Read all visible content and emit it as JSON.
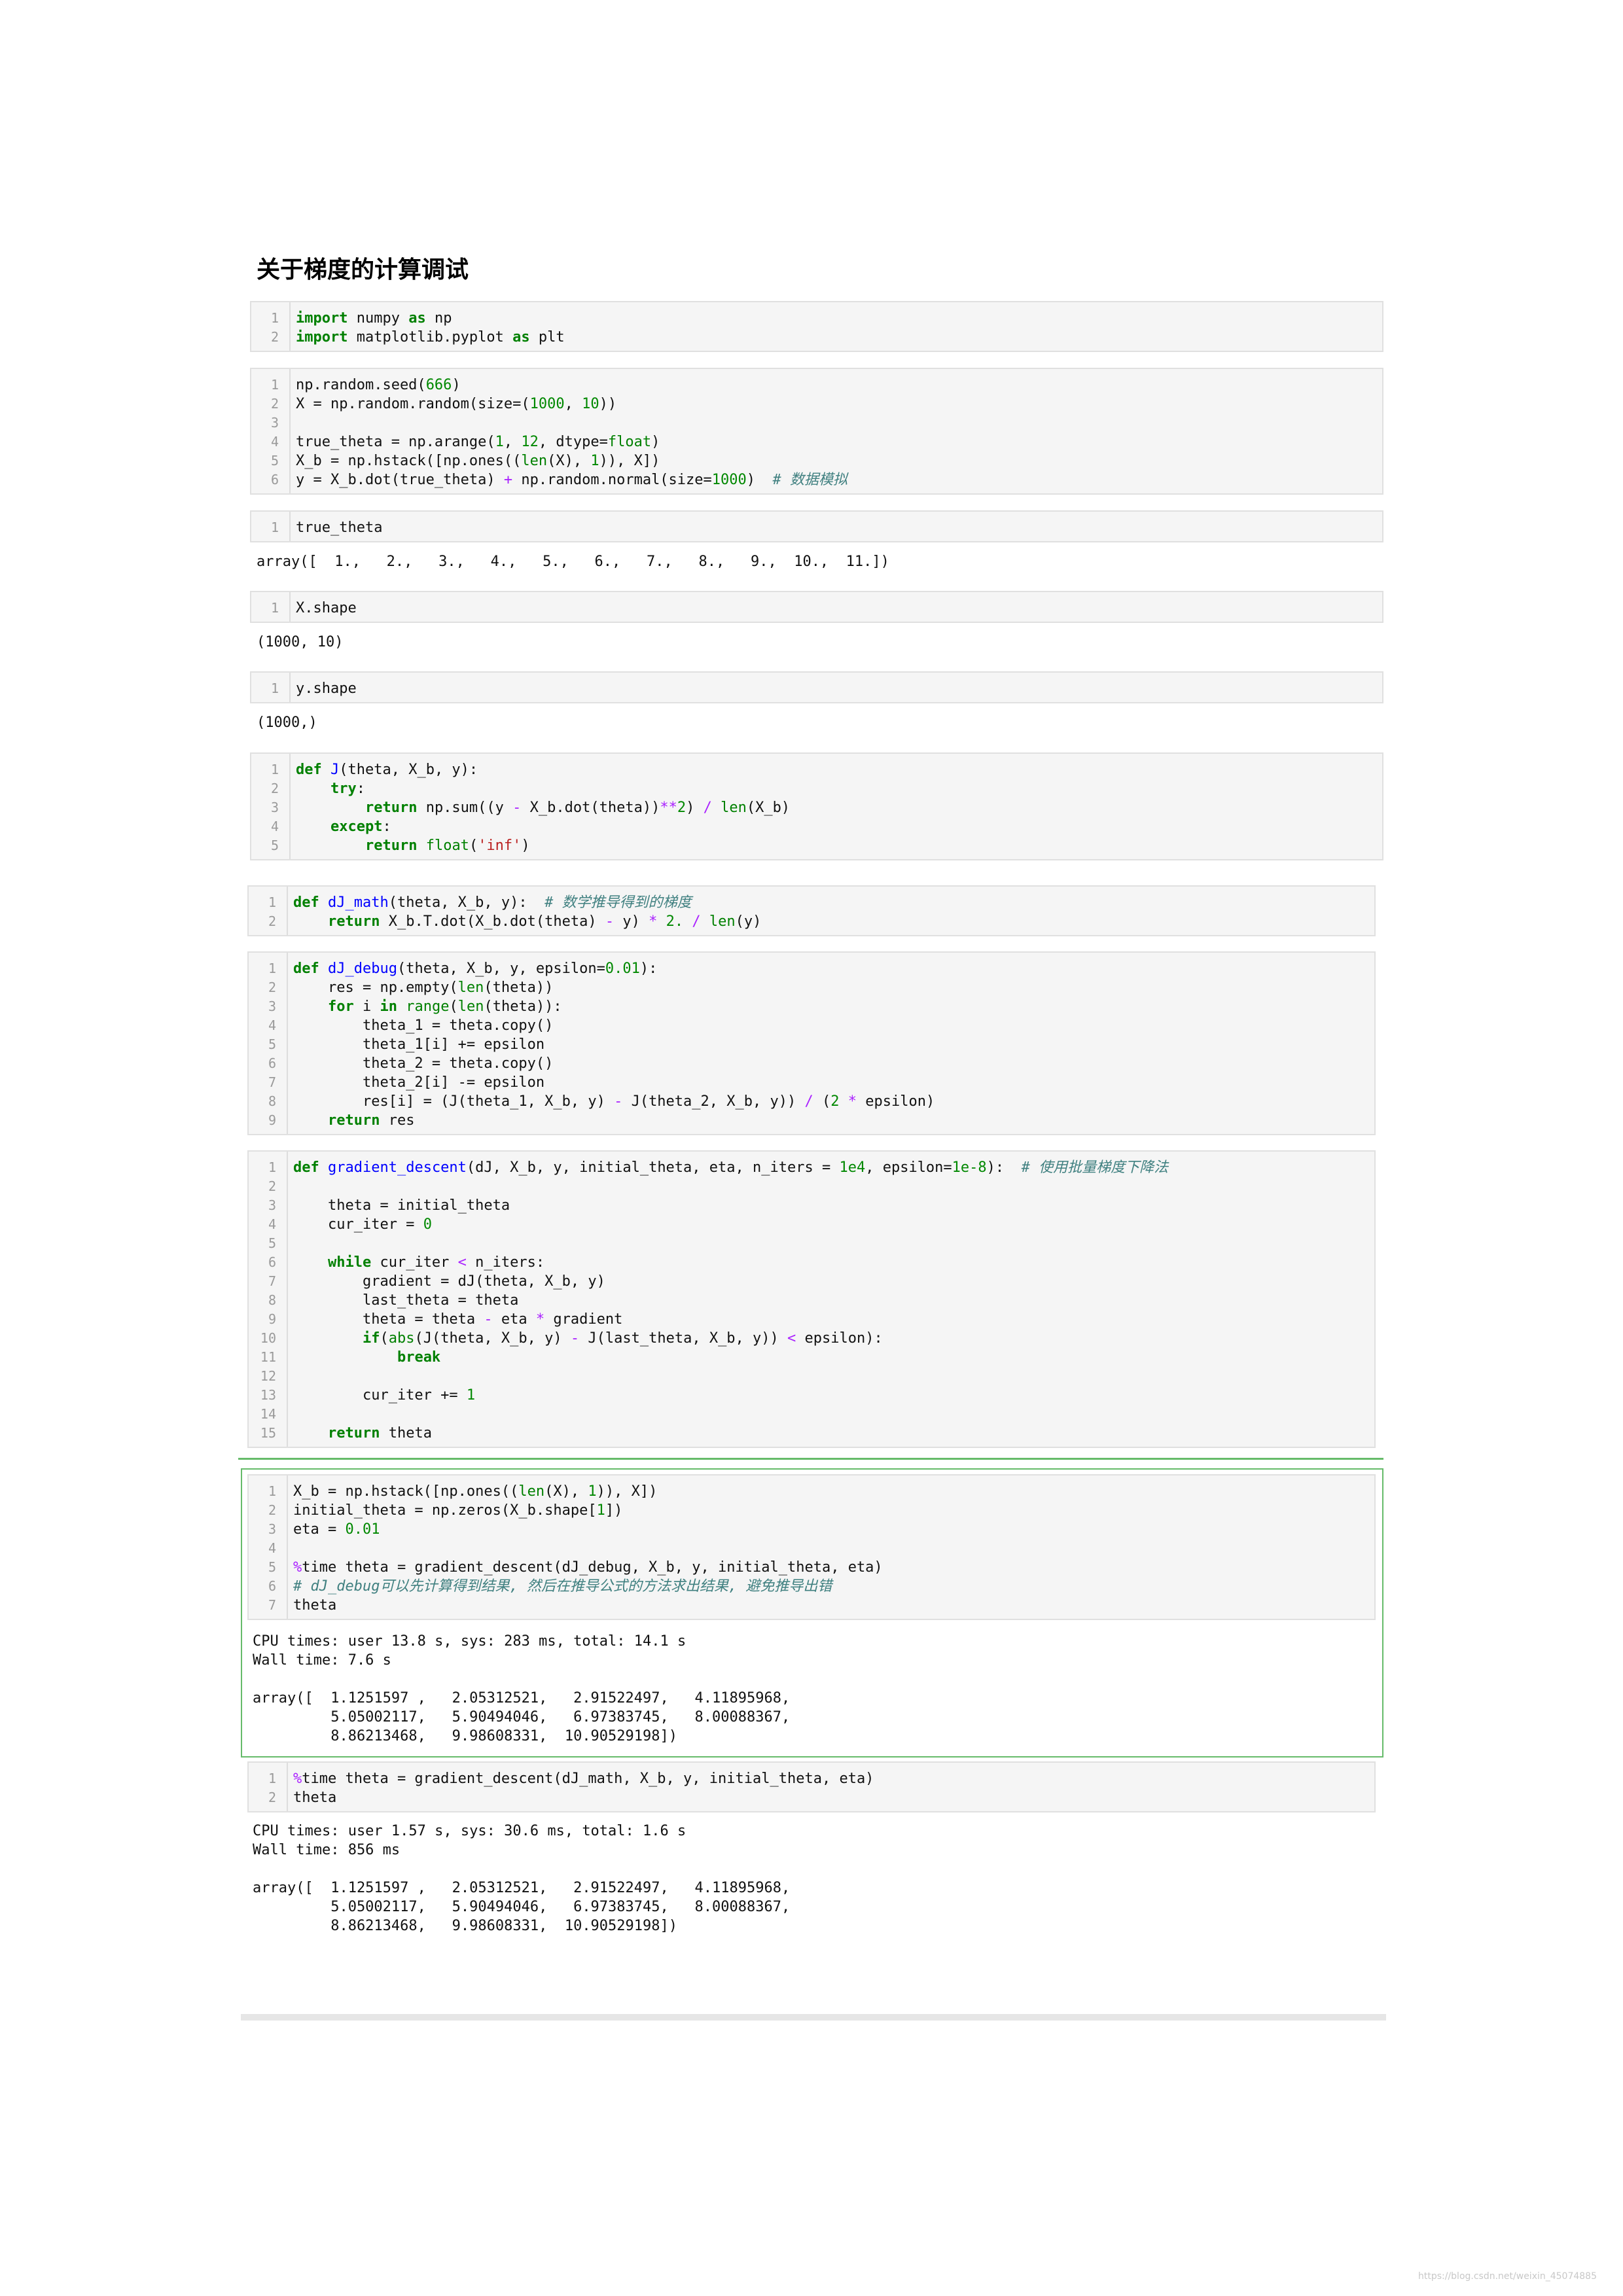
{
  "page": {
    "heading": "关于梯度的计算调试",
    "watermark": "https://blog.csdn.net/weixin_45074885"
  },
  "cells": [
    {
      "lines": [
        [
          [
            "kw",
            "import"
          ],
          [
            "p",
            " numpy "
          ],
          [
            "kw",
            "as"
          ],
          [
            "p",
            " np"
          ]
        ],
        [
          [
            "kw",
            "import"
          ],
          [
            "p",
            " matplotlib.pyplot "
          ],
          [
            "kw",
            "as"
          ],
          [
            "p",
            " plt"
          ]
        ]
      ]
    },
    {
      "lines": [
        [
          [
            "p",
            "np.random.seed("
          ],
          [
            "num",
            "666"
          ],
          [
            "p",
            ")"
          ]
        ],
        [
          [
            "p",
            "X = np.random.random(size=("
          ],
          [
            "num",
            "1000"
          ],
          [
            "p",
            ", "
          ],
          [
            "num",
            "10"
          ],
          [
            "p",
            "))"
          ]
        ],
        [],
        [
          [
            "p",
            "true_theta = np.arange("
          ],
          [
            "num",
            "1"
          ],
          [
            "p",
            ", "
          ],
          [
            "num",
            "12"
          ],
          [
            "p",
            ", dtype="
          ],
          [
            "bi",
            "float"
          ],
          [
            "p",
            ")"
          ]
        ],
        [
          [
            "p",
            "X_b = np.hstack([np.ones(("
          ],
          [
            "bi",
            "len"
          ],
          [
            "p",
            "(X), "
          ],
          [
            "num",
            "1"
          ],
          [
            "p",
            ")), X])"
          ]
        ],
        [
          [
            "p",
            "y = X_b.dot(true_theta) "
          ],
          [
            "op",
            "+"
          ],
          [
            "p",
            " np.random.normal(size="
          ],
          [
            "num",
            "1000"
          ],
          [
            "p",
            ")  "
          ],
          [
            "cm",
            "# 数据模拟"
          ]
        ]
      ]
    },
    {
      "lines": [
        [
          [
            "p",
            "true_theta"
          ]
        ]
      ],
      "output": [
        "array([  1.,   2.,   3.,   4.,   5.,   6.,   7.,   8.,   9.,  10.,  11.])"
      ]
    },
    {
      "lines": [
        [
          [
            "p",
            "X.shape"
          ]
        ]
      ],
      "output": [
        "(1000, 10)"
      ]
    },
    {
      "lines": [
        [
          [
            "p",
            "y.shape"
          ]
        ]
      ],
      "output": [
        "(1000,)"
      ]
    },
    {
      "lines": [
        [
          [
            "kw",
            "def"
          ],
          [
            "p",
            " "
          ],
          [
            "fn",
            "J"
          ],
          [
            "p",
            "(theta, X_b, y):"
          ]
        ],
        [
          [
            "p",
            "    "
          ],
          [
            "kw",
            "try"
          ],
          [
            "p",
            ":"
          ]
        ],
        [
          [
            "p",
            "        "
          ],
          [
            "kw",
            "return"
          ],
          [
            "p",
            " np.sum((y "
          ],
          [
            "op",
            "-"
          ],
          [
            "p",
            " X_b.dot(theta))"
          ],
          [
            "op",
            "**"
          ],
          [
            "num",
            "2"
          ],
          [
            "p",
            ") "
          ],
          [
            "op",
            "/"
          ],
          [
            "p",
            " "
          ],
          [
            "bi",
            "len"
          ],
          [
            "p",
            "(X_b)"
          ]
        ],
        [
          [
            "p",
            "    "
          ],
          [
            "kw",
            "except"
          ],
          [
            "p",
            ":"
          ]
        ],
        [
          [
            "p",
            "        "
          ],
          [
            "kw",
            "return"
          ],
          [
            "p",
            " "
          ],
          [
            "bi",
            "float"
          ],
          [
            "p",
            "("
          ],
          [
            "str",
            "'inf'"
          ],
          [
            "p",
            ")"
          ]
        ]
      ]
    },
    {
      "lines": [
        [
          [
            "kw",
            "def"
          ],
          [
            "p",
            " "
          ],
          [
            "fn",
            "dJ_math"
          ],
          [
            "p",
            "(theta, X_b, y):  "
          ],
          [
            "cm",
            "# 数学推导得到的梯度"
          ]
        ],
        [
          [
            "p",
            "    "
          ],
          [
            "kw",
            "return"
          ],
          [
            "p",
            " X_b.T.dot(X_b.dot(theta) "
          ],
          [
            "op",
            "-"
          ],
          [
            "p",
            " y) "
          ],
          [
            "op",
            "*"
          ],
          [
            "p",
            " "
          ],
          [
            "num",
            "2."
          ],
          [
            "p",
            " "
          ],
          [
            "op",
            "/"
          ],
          [
            "p",
            " "
          ],
          [
            "bi",
            "len"
          ],
          [
            "p",
            "(y)"
          ]
        ]
      ]
    },
    {
      "lines": [
        [
          [
            "kw",
            "def"
          ],
          [
            "p",
            " "
          ],
          [
            "fn",
            "dJ_debug"
          ],
          [
            "p",
            "(theta, X_b, y, epsilon="
          ],
          [
            "num",
            "0.01"
          ],
          [
            "p",
            "):"
          ]
        ],
        [
          [
            "p",
            "    res = np.empty("
          ],
          [
            "bi",
            "len"
          ],
          [
            "p",
            "(theta))"
          ]
        ],
        [
          [
            "p",
            "    "
          ],
          [
            "kw",
            "for"
          ],
          [
            "p",
            " i "
          ],
          [
            "kw",
            "in"
          ],
          [
            "p",
            " "
          ],
          [
            "bi",
            "range"
          ],
          [
            "p",
            "("
          ],
          [
            "bi",
            "len"
          ],
          [
            "p",
            "(theta)):"
          ]
        ],
        [
          [
            "p",
            "        theta_1 = theta.copy()"
          ]
        ],
        [
          [
            "p",
            "        theta_1[i] += epsilon"
          ]
        ],
        [
          [
            "p",
            "        theta_2 = theta.copy()"
          ]
        ],
        [
          [
            "p",
            "        theta_2[i] -= epsilon"
          ]
        ],
        [
          [
            "p",
            "        res[i] = (J(theta_1, X_b, y) "
          ],
          [
            "op",
            "-"
          ],
          [
            "p",
            " J(theta_2, X_b, y)) "
          ],
          [
            "op",
            "/"
          ],
          [
            "p",
            " ("
          ],
          [
            "num",
            "2"
          ],
          [
            "p",
            " "
          ],
          [
            "op",
            "*"
          ],
          [
            "p",
            " epsilon)"
          ]
        ],
        [
          [
            "p",
            "    "
          ],
          [
            "kw",
            "return"
          ],
          [
            "p",
            " res"
          ]
        ]
      ]
    },
    {
      "lines": [
        [
          [
            "kw",
            "def"
          ],
          [
            "p",
            " "
          ],
          [
            "fn",
            "gradient_descent"
          ],
          [
            "p",
            "(dJ, X_b, y, initial_theta, eta, n_iters = "
          ],
          [
            "num",
            "1e4"
          ],
          [
            "p",
            ", epsilon="
          ],
          [
            "num",
            "1e-8"
          ],
          [
            "p",
            "):  "
          ],
          [
            "cm",
            "# 使用批量梯度下降法"
          ]
        ],
        [],
        [
          [
            "p",
            "    theta = initial_theta"
          ]
        ],
        [
          [
            "p",
            "    cur_iter = "
          ],
          [
            "num",
            "0"
          ]
        ],
        [],
        [
          [
            "p",
            "    "
          ],
          [
            "kw",
            "while"
          ],
          [
            "p",
            " cur_iter "
          ],
          [
            "op",
            "<"
          ],
          [
            "p",
            " n_iters:"
          ]
        ],
        [
          [
            "p",
            "        gradient = dJ(theta, X_b, y)"
          ]
        ],
        [
          [
            "p",
            "        last_theta = theta"
          ]
        ],
        [
          [
            "p",
            "        theta = theta "
          ],
          [
            "op",
            "-"
          ],
          [
            "p",
            " eta "
          ],
          [
            "op",
            "*"
          ],
          [
            "p",
            " gradient"
          ]
        ],
        [
          [
            "p",
            "        "
          ],
          [
            "kw",
            "if"
          ],
          [
            "p",
            "("
          ],
          [
            "bi",
            "abs"
          ],
          [
            "p",
            "(J(theta, X_b, y) "
          ],
          [
            "op",
            "-"
          ],
          [
            "p",
            " J(last_theta, X_b, y)) "
          ],
          [
            "op",
            "<"
          ],
          [
            "p",
            " epsilon):"
          ]
        ],
        [
          [
            "p",
            "            "
          ],
          [
            "kw",
            "break"
          ]
        ],
        [],
        [
          [
            "p",
            "        cur_iter += "
          ],
          [
            "num",
            "1"
          ]
        ],
        [],
        [
          [
            "p",
            "    "
          ],
          [
            "kw",
            "return"
          ],
          [
            "p",
            " theta"
          ]
        ]
      ]
    },
    {
      "lines": [
        [
          [
            "p",
            "X_b = np.hstack([np.ones(("
          ],
          [
            "bi",
            "len"
          ],
          [
            "p",
            "(X), "
          ],
          [
            "num",
            "1"
          ],
          [
            "p",
            ")), X])"
          ]
        ],
        [
          [
            "p",
            "initial_theta = np.zeros(X_b.shape["
          ],
          [
            "num",
            "1"
          ],
          [
            "p",
            "])"
          ]
        ],
        [
          [
            "p",
            "eta = "
          ],
          [
            "num",
            "0.01"
          ]
        ],
        [],
        [
          [
            "op",
            "%"
          ],
          [
            "p",
            "time theta = gradient_descent(dJ_debug, X_b, y, initial_theta, eta)"
          ]
        ],
        [
          [
            "cm",
            "# dJ_debug可以先计算得到结果, 然后在推导公式的方法求出结果, 避免推导出错"
          ]
        ],
        [
          [
            "p",
            "theta"
          ]
        ]
      ],
      "output": [
        "CPU times: user 13.8 s, sys: 283 ms, total: 14.1 s",
        "Wall time: 7.6 s",
        "",
        "array([  1.1251597 ,   2.05312521,   2.91522497,   4.11895968,",
        "         5.05002117,   5.90494046,   6.97383745,   8.00088367,",
        "         8.86213468,   9.98608331,  10.90529198])"
      ]
    },
    {
      "lines": [
        [
          [
            "op",
            "%"
          ],
          [
            "p",
            "time theta = gradient_descent(dJ_math, X_b, y, initial_theta, eta)"
          ]
        ],
        [
          [
            "p",
            "theta"
          ]
        ]
      ],
      "output": [
        "CPU times: user 1.57 s, sys: 30.6 ms, total: 1.6 s",
        "Wall time: 856 ms",
        "",
        "array([  1.1251597 ,   2.05312521,   2.91522497,   4.11895968,",
        "         5.05002117,   5.90494046,   6.97383745,   8.00088367,",
        "         8.86213468,   9.98608331,  10.90529198])"
      ]
    }
  ]
}
